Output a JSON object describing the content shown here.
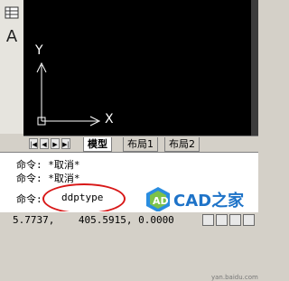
{
  "tabs": {
    "model": "模型",
    "layout1": "布局1",
    "layout2": "布局2"
  },
  "nav": [
    "|◀",
    "◀",
    "▶",
    "▶|"
  ],
  "axis": {
    "x_label": "X",
    "y_label": "Y"
  },
  "command": {
    "history": [
      "命令: *取消*",
      "命令: *取消*"
    ],
    "prompt": "命令:",
    "input": "ddptype"
  },
  "status": {
    "coordinates": "5.7737,    405.5915, 0.0000"
  },
  "watermark": {
    "text": "CAD之家",
    "small": "yan.baidu.com"
  },
  "toolbar": {
    "text_tool": "A"
  },
  "colors": {
    "highlight": "#d81818",
    "canvas": "#000000",
    "accent": "#1e73c8"
  }
}
